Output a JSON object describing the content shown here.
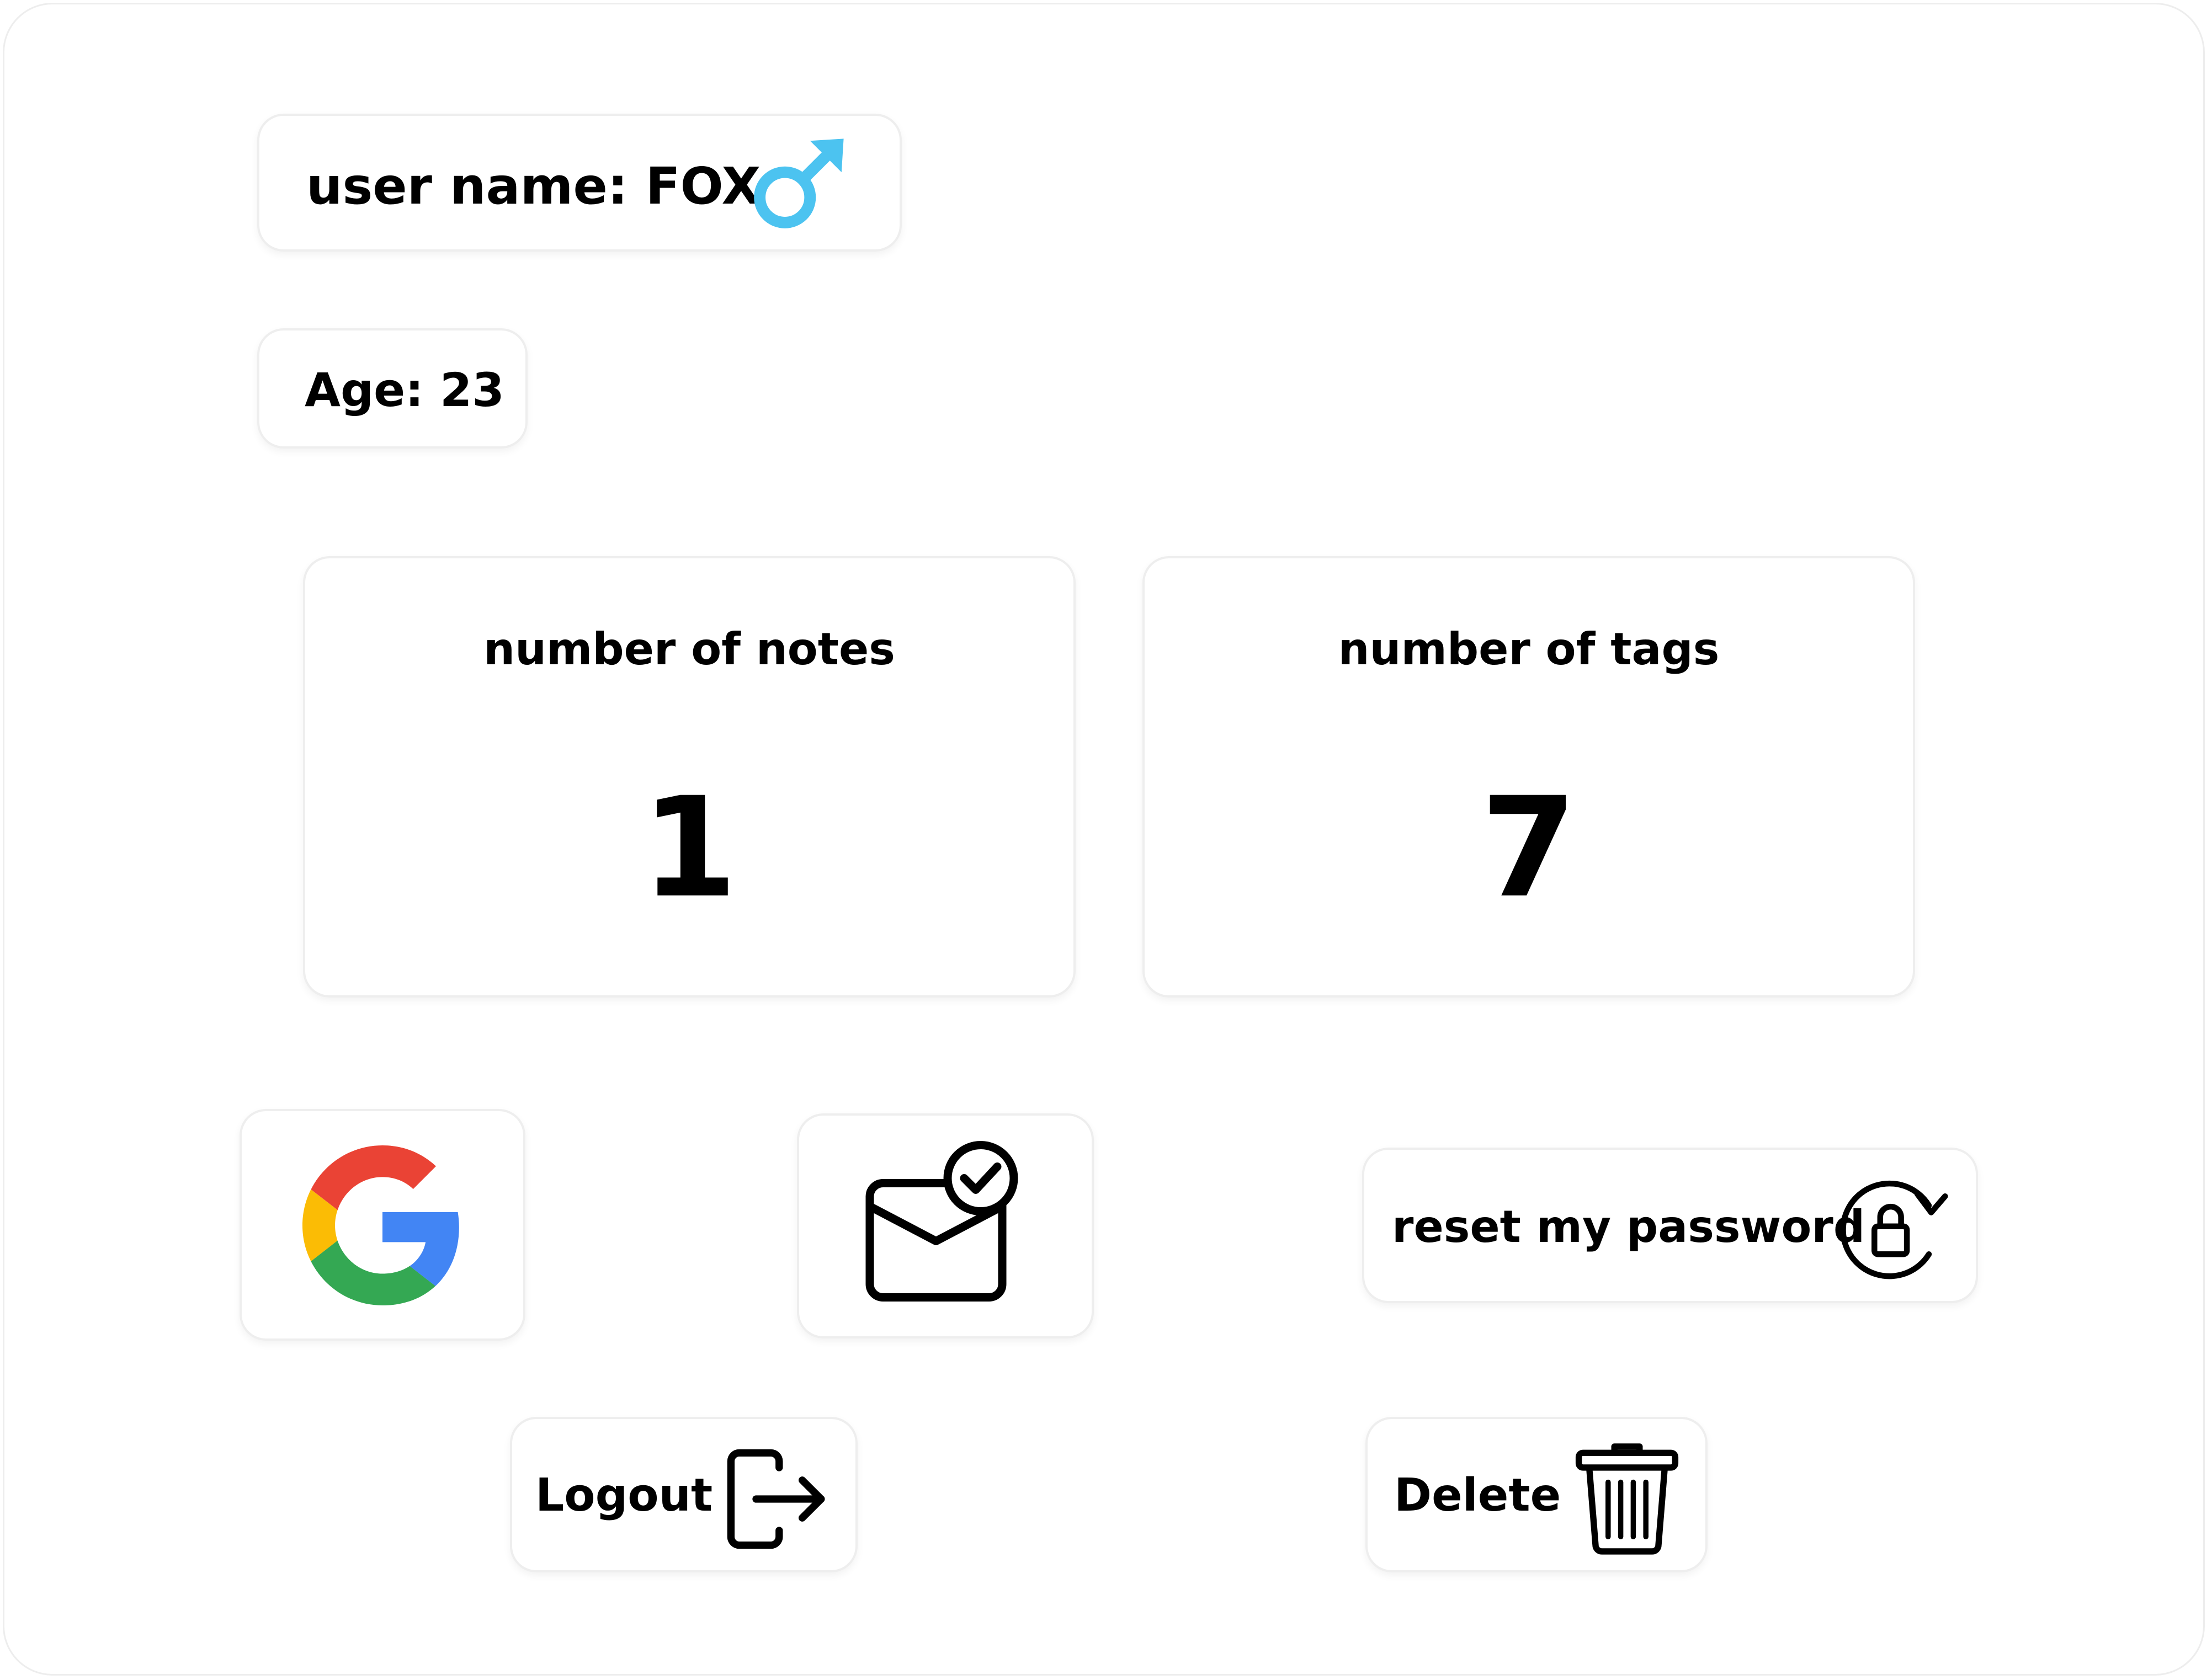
{
  "profile": {
    "username_label": "user name: FOX",
    "gender_icon": "male-symbol-icon",
    "age_label": "Age: 23"
  },
  "stats": [
    {
      "title": "number of notes",
      "value": "1"
    },
    {
      "title": "number of tags",
      "value": "7"
    }
  ],
  "actions": {
    "google_icon": "google-logo-icon",
    "email_verified_icon": "email-verified-icon",
    "reset_password_label": "reset my password",
    "reset_password_icon": "lock-refresh-icon",
    "logout_label": "Logout",
    "logout_icon": "logout-icon",
    "delete_label": "Delete",
    "delete_icon": "trash-icon"
  },
  "colors": {
    "gender_male": "#4cc3f0",
    "google_red": "#ea4335",
    "google_yellow": "#fbbc05",
    "google_green": "#34a853",
    "google_blue": "#4285f4",
    "text": "#000000",
    "border": "#eeeeee"
  }
}
